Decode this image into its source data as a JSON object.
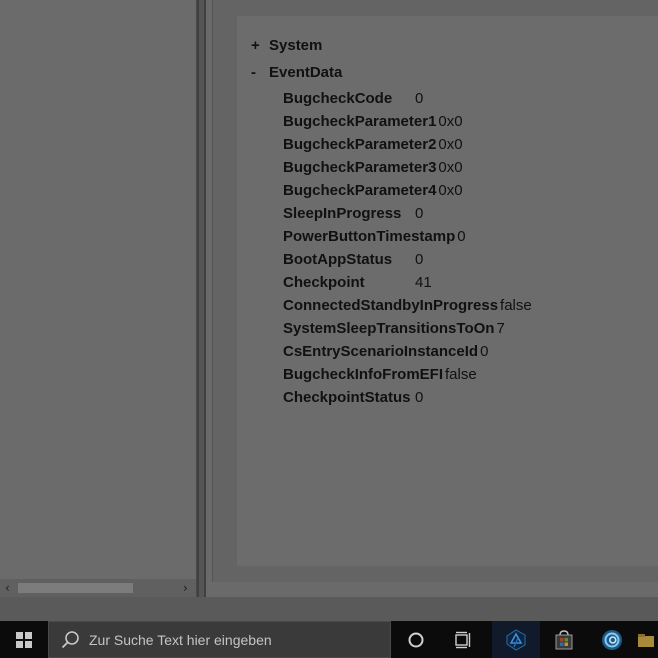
{
  "tree": {
    "nodes": [
      {
        "sign": "+",
        "label": "System"
      },
      {
        "sign": "-",
        "label": "EventData"
      }
    ],
    "event_data": [
      {
        "key": "BugcheckCode",
        "value": "0"
      },
      {
        "key": "BugcheckParameter1",
        "value": "0x0"
      },
      {
        "key": "BugcheckParameter2",
        "value": "0x0"
      },
      {
        "key": "BugcheckParameter3",
        "value": "0x0"
      },
      {
        "key": "BugcheckParameter4",
        "value": "0x0"
      },
      {
        "key": "SleepInProgress",
        "value": "0"
      },
      {
        "key": "PowerButtonTimestamp",
        "value": "0"
      },
      {
        "key": "BootAppStatus",
        "value": "0"
      },
      {
        "key": "Checkpoint",
        "value": "41"
      },
      {
        "key": "ConnectedStandbyInProgress",
        "value": "false"
      },
      {
        "key": "SystemSleepTransitionsToOn",
        "value": "7"
      },
      {
        "key": "CsEntryScenarioInstanceId",
        "value": "0"
      },
      {
        "key": "BugcheckInfoFromEFI",
        "value": "false"
      },
      {
        "key": "CheckpointStatus",
        "value": "0"
      }
    ]
  },
  "scrollbar": {
    "left_arrow": "‹",
    "right_arrow": "›"
  },
  "taskbar": {
    "search_placeholder": "Zur Suche Text hier eingeben",
    "icons": [
      "windows-start-icon",
      "cortana-circle-icon",
      "task-view-icon",
      "visual-studio-icon",
      "microsoft-store-icon",
      "app-swirl-icon",
      "file-explorer-icon"
    ]
  },
  "colors": {
    "taskbar": "#0b0b0b",
    "search_box": "#3a3a3a",
    "content_bg": "#6c6c6c"
  }
}
